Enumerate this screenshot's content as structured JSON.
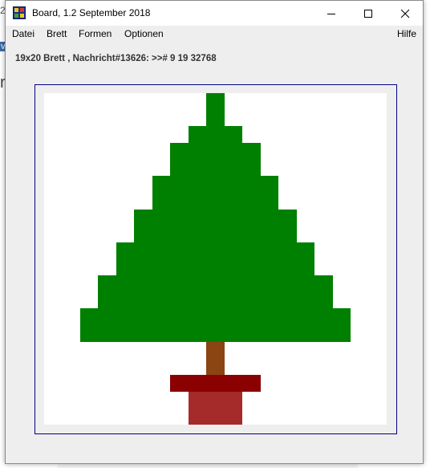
{
  "window": {
    "title": "Board, 1.2 September 2018"
  },
  "background_fragments": {
    "frag1": "2",
    "frag2": "v",
    "frag3": "r"
  },
  "menu": {
    "items": [
      "Datei",
      "Brett",
      "Formen",
      "Optionen"
    ],
    "help": "Hilfe"
  },
  "info_line": "19x20 Brett , Nachricht#13626: >># 9 19 32768",
  "board": {
    "columns": 19,
    "rows": 20,
    "background": "#ffffff",
    "cells": [
      {
        "col": 9,
        "row": 1,
        "color": "#008000"
      },
      {
        "col": 9,
        "row": 2,
        "color": "#008000"
      },
      {
        "col": 8,
        "row": 3,
        "color": "#008000"
      },
      {
        "col": 9,
        "row": 3,
        "color": "#008000"
      },
      {
        "col": 10,
        "row": 3,
        "color": "#008000"
      },
      {
        "col": 7,
        "row": 4,
        "color": "#008000"
      },
      {
        "col": 8,
        "row": 4,
        "color": "#008000"
      },
      {
        "col": 9,
        "row": 4,
        "color": "#008000"
      },
      {
        "col": 10,
        "row": 4,
        "color": "#008000"
      },
      {
        "col": 11,
        "row": 4,
        "color": "#008000"
      },
      {
        "col": 7,
        "row": 5,
        "color": "#008000"
      },
      {
        "col": 8,
        "row": 5,
        "color": "#008000"
      },
      {
        "col": 9,
        "row": 5,
        "color": "#008000"
      },
      {
        "col": 10,
        "row": 5,
        "color": "#008000"
      },
      {
        "col": 11,
        "row": 5,
        "color": "#008000"
      },
      {
        "col": 6,
        "row": 6,
        "color": "#008000"
      },
      {
        "col": 7,
        "row": 6,
        "color": "#008000"
      },
      {
        "col": 8,
        "row": 6,
        "color": "#008000"
      },
      {
        "col": 9,
        "row": 6,
        "color": "#008000"
      },
      {
        "col": 10,
        "row": 6,
        "color": "#008000"
      },
      {
        "col": 11,
        "row": 6,
        "color": "#008000"
      },
      {
        "col": 12,
        "row": 6,
        "color": "#008000"
      },
      {
        "col": 6,
        "row": 7,
        "color": "#008000"
      },
      {
        "col": 7,
        "row": 7,
        "color": "#008000"
      },
      {
        "col": 8,
        "row": 7,
        "color": "#008000"
      },
      {
        "col": 9,
        "row": 7,
        "color": "#008000"
      },
      {
        "col": 10,
        "row": 7,
        "color": "#008000"
      },
      {
        "col": 11,
        "row": 7,
        "color": "#008000"
      },
      {
        "col": 12,
        "row": 7,
        "color": "#008000"
      },
      {
        "col": 5,
        "row": 8,
        "color": "#008000"
      },
      {
        "col": 6,
        "row": 8,
        "color": "#008000"
      },
      {
        "col": 7,
        "row": 8,
        "color": "#008000"
      },
      {
        "col": 8,
        "row": 8,
        "color": "#008000"
      },
      {
        "col": 9,
        "row": 8,
        "color": "#008000"
      },
      {
        "col": 10,
        "row": 8,
        "color": "#008000"
      },
      {
        "col": 11,
        "row": 8,
        "color": "#008000"
      },
      {
        "col": 12,
        "row": 8,
        "color": "#008000"
      },
      {
        "col": 13,
        "row": 8,
        "color": "#008000"
      },
      {
        "col": 5,
        "row": 9,
        "color": "#008000"
      },
      {
        "col": 6,
        "row": 9,
        "color": "#008000"
      },
      {
        "col": 7,
        "row": 9,
        "color": "#008000"
      },
      {
        "col": 8,
        "row": 9,
        "color": "#008000"
      },
      {
        "col": 9,
        "row": 9,
        "color": "#008000"
      },
      {
        "col": 10,
        "row": 9,
        "color": "#008000"
      },
      {
        "col": 11,
        "row": 9,
        "color": "#008000"
      },
      {
        "col": 12,
        "row": 9,
        "color": "#008000"
      },
      {
        "col": 13,
        "row": 9,
        "color": "#008000"
      },
      {
        "col": 4,
        "row": 10,
        "color": "#008000"
      },
      {
        "col": 5,
        "row": 10,
        "color": "#008000"
      },
      {
        "col": 6,
        "row": 10,
        "color": "#008000"
      },
      {
        "col": 7,
        "row": 10,
        "color": "#008000"
      },
      {
        "col": 8,
        "row": 10,
        "color": "#008000"
      },
      {
        "col": 9,
        "row": 10,
        "color": "#008000"
      },
      {
        "col": 10,
        "row": 10,
        "color": "#008000"
      },
      {
        "col": 11,
        "row": 10,
        "color": "#008000"
      },
      {
        "col": 12,
        "row": 10,
        "color": "#008000"
      },
      {
        "col": 13,
        "row": 10,
        "color": "#008000"
      },
      {
        "col": 14,
        "row": 10,
        "color": "#008000"
      },
      {
        "col": 4,
        "row": 11,
        "color": "#008000"
      },
      {
        "col": 5,
        "row": 11,
        "color": "#008000"
      },
      {
        "col": 6,
        "row": 11,
        "color": "#008000"
      },
      {
        "col": 7,
        "row": 11,
        "color": "#008000"
      },
      {
        "col": 8,
        "row": 11,
        "color": "#008000"
      },
      {
        "col": 9,
        "row": 11,
        "color": "#008000"
      },
      {
        "col": 10,
        "row": 11,
        "color": "#008000"
      },
      {
        "col": 11,
        "row": 11,
        "color": "#008000"
      },
      {
        "col": 12,
        "row": 11,
        "color": "#008000"
      },
      {
        "col": 13,
        "row": 11,
        "color": "#008000"
      },
      {
        "col": 14,
        "row": 11,
        "color": "#008000"
      },
      {
        "col": 3,
        "row": 12,
        "color": "#008000"
      },
      {
        "col": 4,
        "row": 12,
        "color": "#008000"
      },
      {
        "col": 5,
        "row": 12,
        "color": "#008000"
      },
      {
        "col": 6,
        "row": 12,
        "color": "#008000"
      },
      {
        "col": 7,
        "row": 12,
        "color": "#008000"
      },
      {
        "col": 8,
        "row": 12,
        "color": "#008000"
      },
      {
        "col": 9,
        "row": 12,
        "color": "#008000"
      },
      {
        "col": 10,
        "row": 12,
        "color": "#008000"
      },
      {
        "col": 11,
        "row": 12,
        "color": "#008000"
      },
      {
        "col": 12,
        "row": 12,
        "color": "#008000"
      },
      {
        "col": 13,
        "row": 12,
        "color": "#008000"
      },
      {
        "col": 14,
        "row": 12,
        "color": "#008000"
      },
      {
        "col": 15,
        "row": 12,
        "color": "#008000"
      },
      {
        "col": 3,
        "row": 13,
        "color": "#008000"
      },
      {
        "col": 4,
        "row": 13,
        "color": "#008000"
      },
      {
        "col": 5,
        "row": 13,
        "color": "#008000"
      },
      {
        "col": 6,
        "row": 13,
        "color": "#008000"
      },
      {
        "col": 7,
        "row": 13,
        "color": "#008000"
      },
      {
        "col": 8,
        "row": 13,
        "color": "#008000"
      },
      {
        "col": 9,
        "row": 13,
        "color": "#008000"
      },
      {
        "col": 10,
        "row": 13,
        "color": "#008000"
      },
      {
        "col": 11,
        "row": 13,
        "color": "#008000"
      },
      {
        "col": 12,
        "row": 13,
        "color": "#008000"
      },
      {
        "col": 13,
        "row": 13,
        "color": "#008000"
      },
      {
        "col": 14,
        "row": 13,
        "color": "#008000"
      },
      {
        "col": 15,
        "row": 13,
        "color": "#008000"
      },
      {
        "col": 2,
        "row": 14,
        "color": "#008000"
      },
      {
        "col": 3,
        "row": 14,
        "color": "#008000"
      },
      {
        "col": 4,
        "row": 14,
        "color": "#008000"
      },
      {
        "col": 5,
        "row": 14,
        "color": "#008000"
      },
      {
        "col": 6,
        "row": 14,
        "color": "#008000"
      },
      {
        "col": 7,
        "row": 14,
        "color": "#008000"
      },
      {
        "col": 8,
        "row": 14,
        "color": "#008000"
      },
      {
        "col": 9,
        "row": 14,
        "color": "#008000"
      },
      {
        "col": 10,
        "row": 14,
        "color": "#008000"
      },
      {
        "col": 11,
        "row": 14,
        "color": "#008000"
      },
      {
        "col": 12,
        "row": 14,
        "color": "#008000"
      },
      {
        "col": 13,
        "row": 14,
        "color": "#008000"
      },
      {
        "col": 14,
        "row": 14,
        "color": "#008000"
      },
      {
        "col": 15,
        "row": 14,
        "color": "#008000"
      },
      {
        "col": 16,
        "row": 14,
        "color": "#008000"
      },
      {
        "col": 2,
        "row": 15,
        "color": "#008000"
      },
      {
        "col": 3,
        "row": 15,
        "color": "#008000"
      },
      {
        "col": 4,
        "row": 15,
        "color": "#008000"
      },
      {
        "col": 5,
        "row": 15,
        "color": "#008000"
      },
      {
        "col": 6,
        "row": 15,
        "color": "#008000"
      },
      {
        "col": 7,
        "row": 15,
        "color": "#008000"
      },
      {
        "col": 8,
        "row": 15,
        "color": "#008000"
      },
      {
        "col": 9,
        "row": 15,
        "color": "#008000"
      },
      {
        "col": 10,
        "row": 15,
        "color": "#008000"
      },
      {
        "col": 11,
        "row": 15,
        "color": "#008000"
      },
      {
        "col": 12,
        "row": 15,
        "color": "#008000"
      },
      {
        "col": 13,
        "row": 15,
        "color": "#008000"
      },
      {
        "col": 14,
        "row": 15,
        "color": "#008000"
      },
      {
        "col": 15,
        "row": 15,
        "color": "#008000"
      },
      {
        "col": 16,
        "row": 15,
        "color": "#008000"
      },
      {
        "col": 9,
        "row": 16,
        "color": "#8b4513"
      },
      {
        "col": 9,
        "row": 17,
        "color": "#8b4513"
      },
      {
        "col": 7,
        "row": 18,
        "color": "#8b0000"
      },
      {
        "col": 8,
        "row": 18,
        "color": "#8b0000"
      },
      {
        "col": 9,
        "row": 18,
        "color": "#8b0000"
      },
      {
        "col": 10,
        "row": 18,
        "color": "#8b0000"
      },
      {
        "col": 11,
        "row": 18,
        "color": "#8b0000"
      },
      {
        "col": 8,
        "row": 19,
        "color": "#a52a2a"
      },
      {
        "col": 9,
        "row": 19,
        "color": "#a52a2a"
      },
      {
        "col": 10,
        "row": 19,
        "color": "#a52a2a"
      },
      {
        "col": 8,
        "row": 20,
        "color": "#a52a2a"
      },
      {
        "col": 9,
        "row": 20,
        "color": "#a52a2a"
      },
      {
        "col": 10,
        "row": 20,
        "color": "#a52a2a"
      }
    ]
  }
}
